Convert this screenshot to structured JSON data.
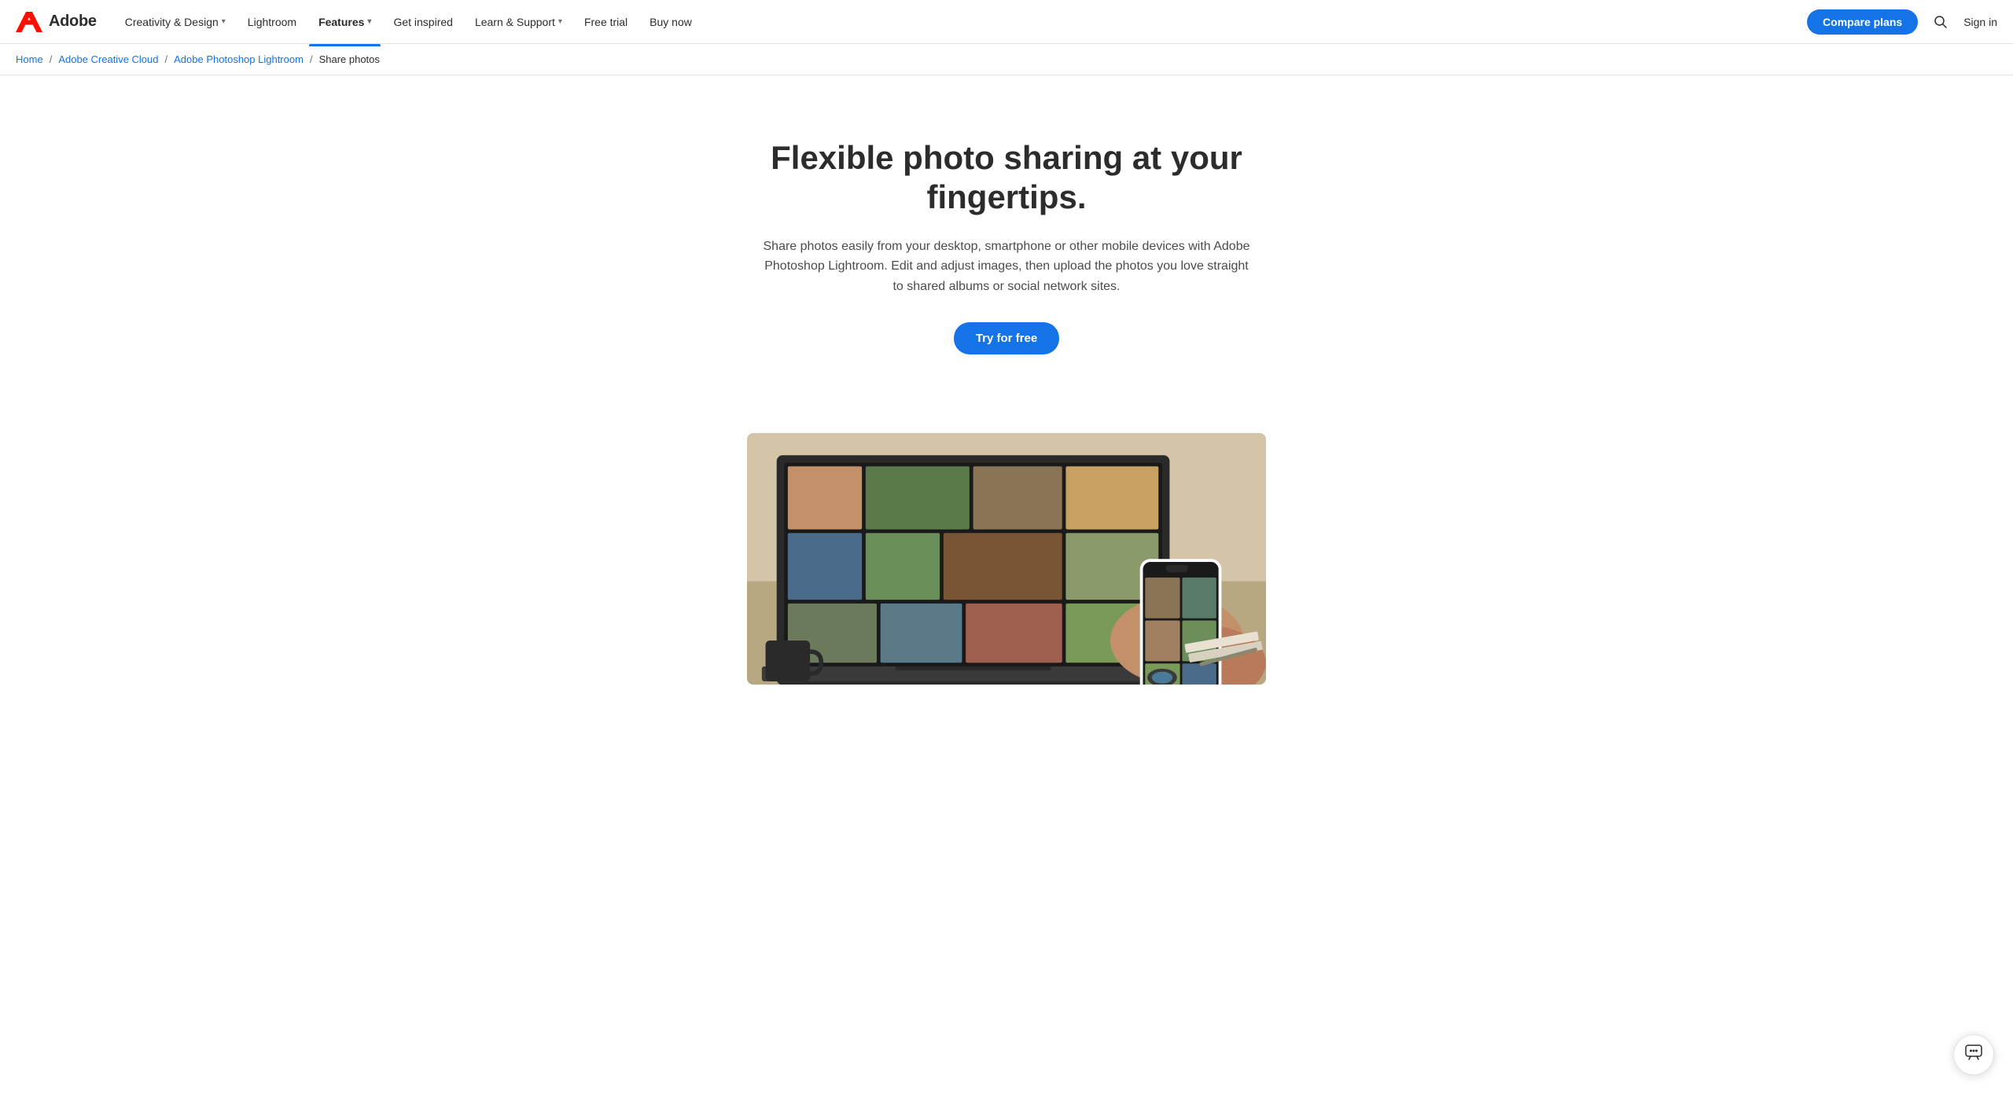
{
  "header": {
    "logo_text": "Adobe",
    "nav_items": [
      {
        "label": "Creativity & Design",
        "has_chevron": true,
        "active": false
      },
      {
        "label": "Lightroom",
        "has_chevron": false,
        "active": false
      },
      {
        "label": "Features",
        "has_chevron": true,
        "active": true
      },
      {
        "label": "Get inspired",
        "has_chevron": false,
        "active": false
      },
      {
        "label": "Learn & Support",
        "has_chevron": true,
        "active": false
      },
      {
        "label": "Free trial",
        "has_chevron": false,
        "active": false
      },
      {
        "label": "Buy now",
        "has_chevron": false,
        "active": false
      }
    ],
    "compare_plans_label": "Compare plans",
    "sign_in_label": "Sign in"
  },
  "breadcrumb": {
    "items": [
      {
        "label": "Home",
        "link": true
      },
      {
        "label": "Adobe Creative Cloud",
        "link": true
      },
      {
        "label": "Adobe Photoshop Lightroom",
        "link": true
      },
      {
        "label": "Share photos",
        "link": false
      }
    ]
  },
  "hero": {
    "title": "Flexible photo sharing at your fingertips.",
    "description": "Share photos easily from your desktop, smartphone or other mobile devices with Adobe Photoshop Lightroom. Edit and adjust images, then upload the photos you love straight to shared albums or social network sites.",
    "cta_label": "Try for free"
  },
  "chat": {
    "icon_label": "💬"
  }
}
